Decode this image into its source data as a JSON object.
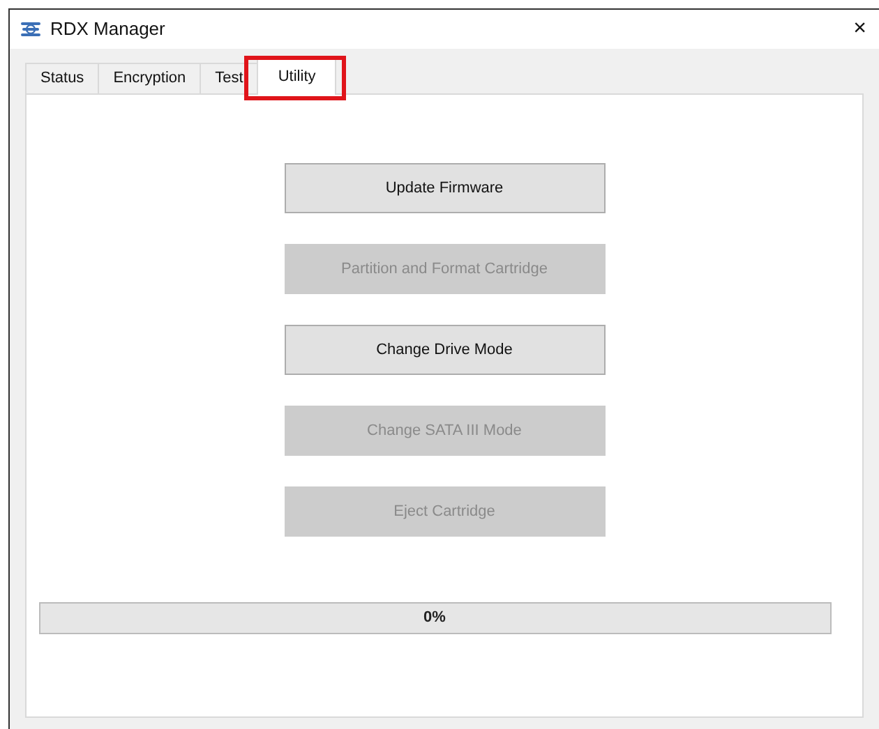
{
  "window": {
    "title": "RDX Manager",
    "close": "×"
  },
  "tabs": [
    {
      "label": "Status",
      "selected": false,
      "highlighted": false
    },
    {
      "label": "Encryption",
      "selected": false,
      "highlighted": false
    },
    {
      "label": "Test",
      "selected": false,
      "highlighted": false
    },
    {
      "label": "Utility",
      "selected": true,
      "highlighted": true
    }
  ],
  "buttons": [
    {
      "label": "Update Firmware",
      "disabled": false
    },
    {
      "label": "Partition and Format Cartridge",
      "disabled": true
    },
    {
      "label": "Change Drive Mode",
      "disabled": false
    },
    {
      "label": "Change SATA III Mode",
      "disabled": true
    },
    {
      "label": "Eject Cartridge",
      "disabled": true
    }
  ],
  "progress": {
    "level": 0,
    "reading": "0%"
  }
}
